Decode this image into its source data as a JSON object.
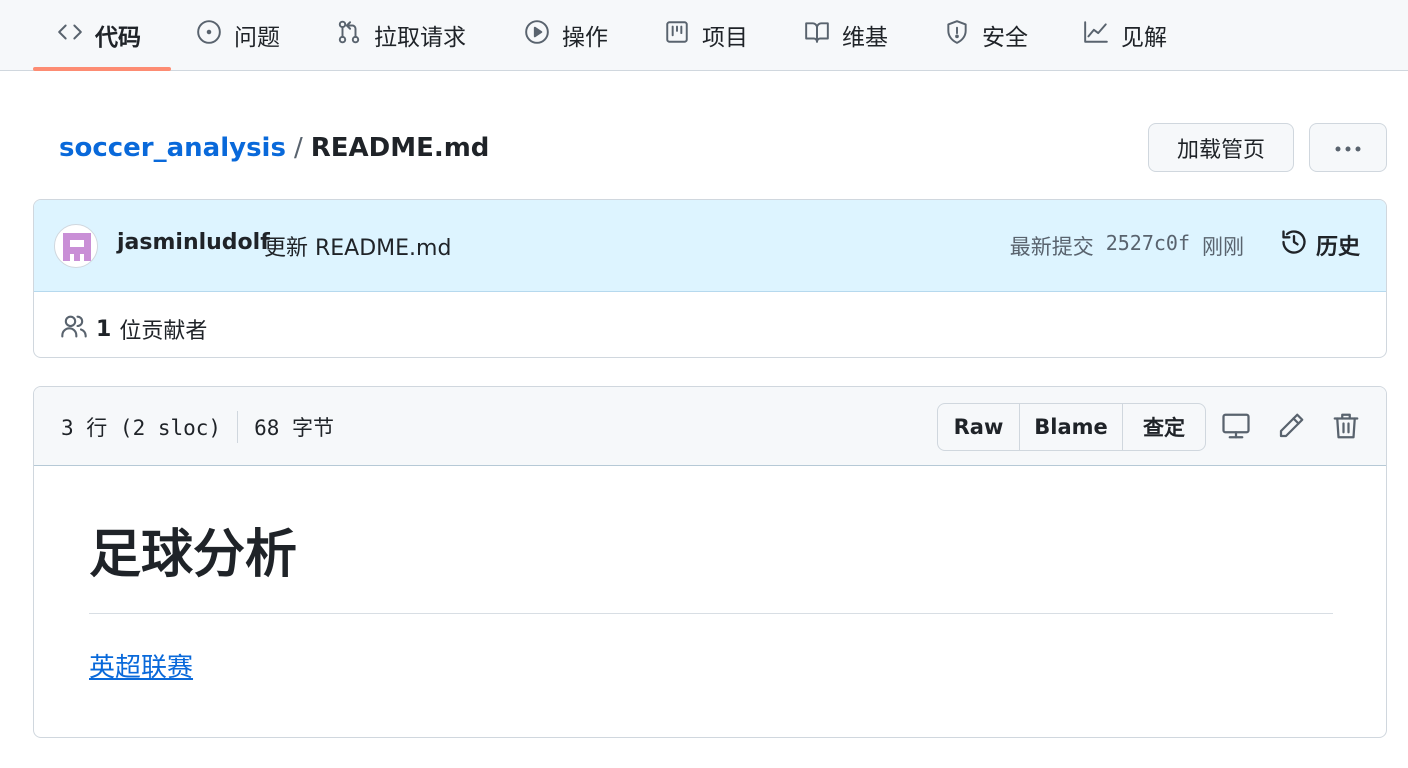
{
  "nav": {
    "tabs": [
      {
        "label": "代码",
        "icon": "code-icon",
        "active": true
      },
      {
        "label": "问题",
        "icon": "issue-icon"
      },
      {
        "label": "拉取请求",
        "icon": "pull-request-icon"
      },
      {
        "label": "操作",
        "icon": "play-icon"
      },
      {
        "label": "项目",
        "icon": "project-icon"
      },
      {
        "label": "维基",
        "icon": "book-icon"
      },
      {
        "label": "安全",
        "icon": "shield-icon"
      },
      {
        "label": "见解",
        "icon": "graph-icon"
      }
    ]
  },
  "breadcrumb": {
    "repo": "soccer_analysis",
    "separator": "/",
    "file": "README.md"
  },
  "actions": {
    "download_label": "加载管页",
    "more_icon": "kebab-horizontal-icon"
  },
  "commit": {
    "author": "jasminludolf",
    "message": "更新 README.md",
    "latest_label": "最新提交",
    "sha": "2527c0f",
    "time": "刚刚",
    "history_label": "历史",
    "contributors_count": "1",
    "contributors_label": "位贡献者"
  },
  "file": {
    "lines_info": "3 行 (2 sloc)",
    "size_info": "68 字节",
    "raw_label": "Raw",
    "blame_label": "Blame",
    "check_label": "查定"
  },
  "readme": {
    "heading": "足球分析",
    "link_text": "英超联赛"
  },
  "colors": {
    "accent_link": "#0969da",
    "tab_underline": "#fd8c73",
    "commit_header_bg": "#ddf4ff",
    "avatar_color": "#c98fd6"
  }
}
